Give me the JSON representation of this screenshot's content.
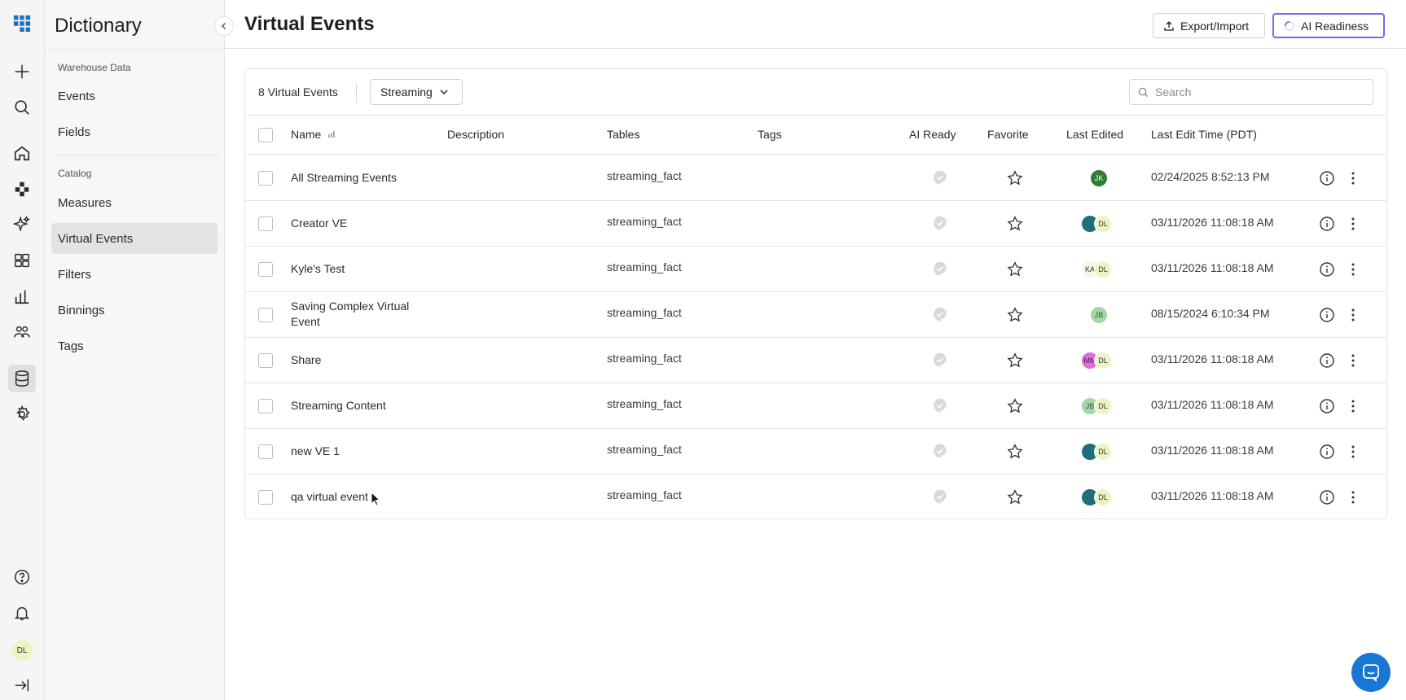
{
  "sidebar": {
    "title": "Dictionary",
    "groups": [
      {
        "label": "Warehouse Data",
        "items": [
          {
            "label": "Events"
          },
          {
            "label": "Fields"
          }
        ]
      },
      {
        "label": "Catalog",
        "items": [
          {
            "label": "Measures"
          },
          {
            "label": "Virtual Events"
          },
          {
            "label": "Filters"
          },
          {
            "label": "Binnings"
          },
          {
            "label": "Tags"
          }
        ]
      }
    ],
    "active_item": "Virtual Events"
  },
  "rail": {
    "icons": [
      "apps-grid-icon",
      "plus-icon",
      "search-icon",
      "home-icon",
      "nodes-icon",
      "sparkle-icon",
      "dashboard-icon",
      "chart-icon",
      "users-icon",
      "database-icon",
      "gear-icon",
      "help-icon",
      "bell-icon",
      "expand-icon"
    ],
    "user_initials": "DL"
  },
  "header": {
    "title": "Virtual Events",
    "export_label": "Export/Import",
    "ai_label": "AI Readiness"
  },
  "toolbar": {
    "count_label": "8 Virtual Events",
    "filter_value": "Streaming",
    "search_placeholder": "Search"
  },
  "table": {
    "columns": [
      "Name",
      "Description",
      "Tables",
      "Tags",
      "AI Ready",
      "Favorite",
      "Last Edited",
      "Last Edit Time (PDT)"
    ],
    "rows": [
      {
        "name": "All Streaming Events",
        "table": "streaming_fact",
        "editors": [
          {
            "initials": "JK",
            "color": "#2e7d32",
            "text": "#ffffff"
          }
        ],
        "time": "02/24/2025 8:52:13 PM"
      },
      {
        "name": "Creator VE",
        "table": "streaming_fact",
        "editors": [
          {
            "initials": "",
            "color": "#1f6f7a",
            "text": "#ffffff"
          },
          {
            "initials": "DL",
            "color": "#eef3c4",
            "text": "#333333"
          }
        ],
        "time": "03/11/2026 11:08:18 AM"
      },
      {
        "name": "Kyle's Test",
        "table": "streaming_fact",
        "editors": [
          {
            "initials": "KA",
            "color": "#f6f6e4",
            "text": "#333333"
          },
          {
            "initials": "DL",
            "color": "#eef3c4",
            "text": "#333333"
          }
        ],
        "time": "03/11/2026 11:08:18 AM"
      },
      {
        "name": "Saving Complex Virtual Event",
        "table": "streaming_fact",
        "editors": [
          {
            "initials": "JB",
            "color": "#a5d6a7",
            "text": "#2e5d30"
          }
        ],
        "time": "08/15/2024 6:10:34 PM"
      },
      {
        "name": "Share",
        "table": "streaming_fact",
        "editors": [
          {
            "initials": "MM",
            "color": "#e06be0",
            "text": "#333333"
          },
          {
            "initials": "DL",
            "color": "#eef3c4",
            "text": "#333333"
          }
        ],
        "time": "03/11/2026 11:08:18 AM"
      },
      {
        "name": "Streaming Content",
        "table": "streaming_fact",
        "editors": [
          {
            "initials": "JB",
            "color": "#a5d6a7",
            "text": "#2e5d30"
          },
          {
            "initials": "DL",
            "color": "#eef3c4",
            "text": "#333333"
          }
        ],
        "time": "03/11/2026 11:08:18 AM"
      },
      {
        "name": "new VE 1",
        "table": "streaming_fact",
        "editors": [
          {
            "initials": "",
            "color": "#1f6f7a",
            "text": "#ffffff"
          },
          {
            "initials": "DL",
            "color": "#eef3c4",
            "text": "#333333"
          }
        ],
        "time": "03/11/2026 11:08:18 AM"
      },
      {
        "name": "qa virtual event",
        "table": "streaming_fact",
        "editors": [
          {
            "initials": "",
            "color": "#1f6f7a",
            "text": "#ffffff"
          },
          {
            "initials": "DL",
            "color": "#eef3c4",
            "text": "#333333"
          }
        ],
        "time": "03/11/2026 11:08:18 AM"
      }
    ]
  },
  "colors": {
    "accent": "#8b5cf6",
    "brand": "#1877d4",
    "ai_check": "#d9d9d9"
  }
}
